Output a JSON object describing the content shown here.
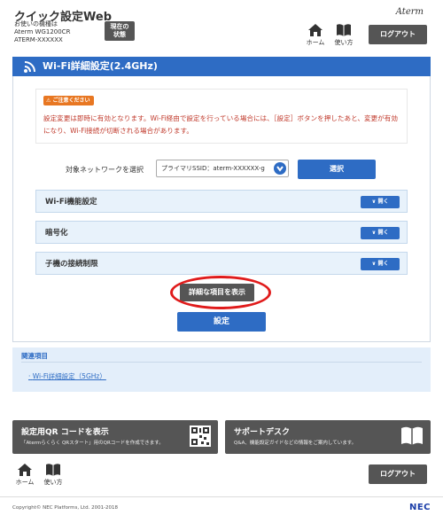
{
  "header": {
    "title": "クイック設定Web",
    "model_line1": "お使いの機種は",
    "model_line2": "Aterm WG1200CR",
    "model_line3": "ATERM-XXXXXX",
    "status_label_1": "現在の",
    "status_label_2": "状態",
    "brand": "Aterm",
    "home_label": "ホーム",
    "manual_label": "使い方",
    "logout_label": "ログアウト"
  },
  "page": {
    "title": "Wi-Fi詳細設定(2.4GHz)"
  },
  "notice": {
    "badge": "ご注意ください",
    "text": "設定変更は即時に有効となります。Wi-Fi経由で設定を行っている場合には、［設定］ボタンを押したあと、変更が有効になり、Wi-Fi接続が切断される場合があります。"
  },
  "network": {
    "label": "対象ネットワークを選択",
    "selected": "プライマリSSID：aterm-XXXXXX-g",
    "select_button": "選択"
  },
  "accordions": [
    {
      "label": "Wi-Fi機能設定",
      "button": "開く"
    },
    {
      "label": "暗号化",
      "button": "開く"
    },
    {
      "label": "子機の接続制限",
      "button": "開く"
    }
  ],
  "actions": {
    "detail_button": "詳細な項目を表示",
    "set_button": "設定"
  },
  "related": {
    "title": "関連項目",
    "link": "Wi-Fi詳細設定（5GHz）"
  },
  "features": {
    "qr_title": "設定用QR コードを表示",
    "qr_desc": "「Atermらくらく QRスタート」用のQRコードを作成できます。",
    "support_title": "サポートデスク",
    "support_desc": "Q&A、機能設定ガイドなどの情報をご案内しています。"
  },
  "footer": {
    "home_label": "ホーム",
    "manual_label": "使い方",
    "logout_label": "ログアウト",
    "copyright": "Copyright© NEC Platforms, Ltd. 2001-2018",
    "nec": "NEC"
  },
  "colors": {
    "primary_blue": "#2e6cc4",
    "dark_button": "#555555",
    "notice_red": "#c0392b",
    "highlight_ring": "#e01b1b"
  }
}
